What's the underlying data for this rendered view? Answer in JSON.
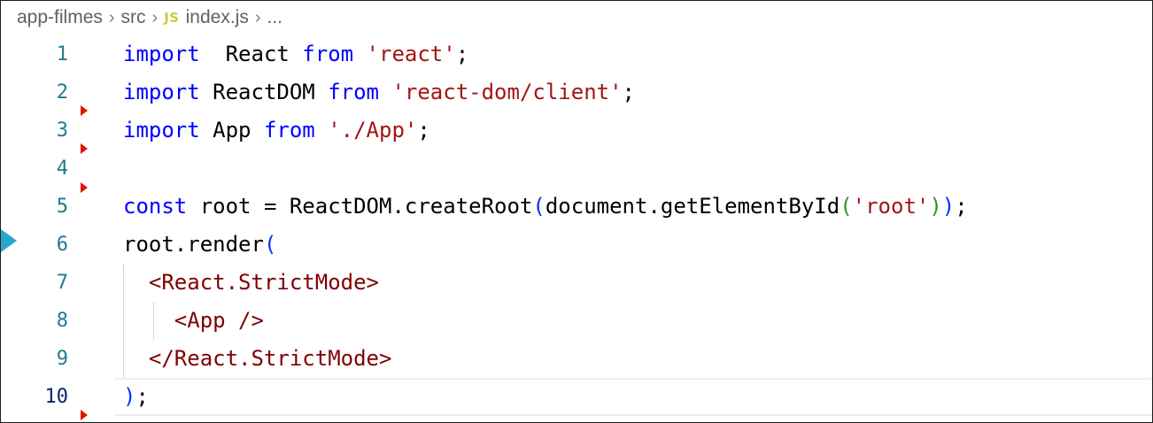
{
  "breadcrumb": {
    "folder": "app-filmes",
    "subfolder": "src",
    "file_icon": "JS",
    "file": "index.js",
    "more": "..."
  },
  "editor": {
    "language": "javascript",
    "current_line": 10,
    "colors": {
      "keyword": "#0000ff",
      "string": "#a31515",
      "tag": "#800000",
      "bracket_1": "#0431fa",
      "bracket_2": "#319331",
      "bracket_3": "#7b3814",
      "line_number": "#237893",
      "change_marker": "#e51400",
      "breakpoint_arrow": "#26a6c9"
    },
    "lines": [
      {
        "n": "1",
        "tokens": [
          [
            "kw",
            "import"
          ],
          [
            "",
            "  React "
          ],
          [
            "kw",
            "from"
          ],
          [
            "str",
            " 'react'"
          ],
          [
            "",
            ";"
          ]
        ]
      },
      {
        "n": "2",
        "tokens": [
          [
            "kw",
            "import"
          ],
          [
            "",
            " ReactDOM "
          ],
          [
            "kw",
            "from"
          ],
          [
            "str",
            " 'react-dom/client'"
          ],
          [
            "",
            ";"
          ]
        ]
      },
      {
        "n": "3",
        "tokens": [
          [
            "kw",
            "import"
          ],
          [
            "",
            " App "
          ],
          [
            "kw",
            "from"
          ],
          [
            "str",
            " './App'"
          ],
          [
            "",
            ";"
          ]
        ]
      },
      {
        "n": "4",
        "tokens": []
      },
      {
        "n": "5",
        "tokens": [
          [
            "kw",
            "const"
          ],
          [
            "",
            " root = ReactDOM.createRoot"
          ],
          [
            "br1",
            "("
          ],
          [
            "",
            "document.getElementById"
          ],
          [
            "br2",
            "("
          ],
          [
            "str",
            "'root'"
          ],
          [
            "br2",
            ")"
          ],
          [
            "br1",
            ")"
          ],
          [
            "",
            ";"
          ]
        ]
      },
      {
        "n": "6",
        "tokens": [
          [
            "",
            "root.render"
          ],
          [
            "br1",
            "("
          ]
        ]
      },
      {
        "n": "7",
        "tokens": [
          [
            "",
            "  "
          ],
          [
            "tag",
            "<React.StrictMode>"
          ]
        ]
      },
      {
        "n": "8",
        "tokens": [
          [
            "",
            "    "
          ],
          [
            "tag",
            "<App />"
          ]
        ]
      },
      {
        "n": "9",
        "tokens": [
          [
            "",
            "  "
          ],
          [
            "tag",
            "</React.StrictMode>"
          ]
        ]
      },
      {
        "n": "10",
        "tokens": [
          [
            "br1",
            ")"
          ],
          [
            "",
            ";"
          ]
        ]
      }
    ]
  }
}
